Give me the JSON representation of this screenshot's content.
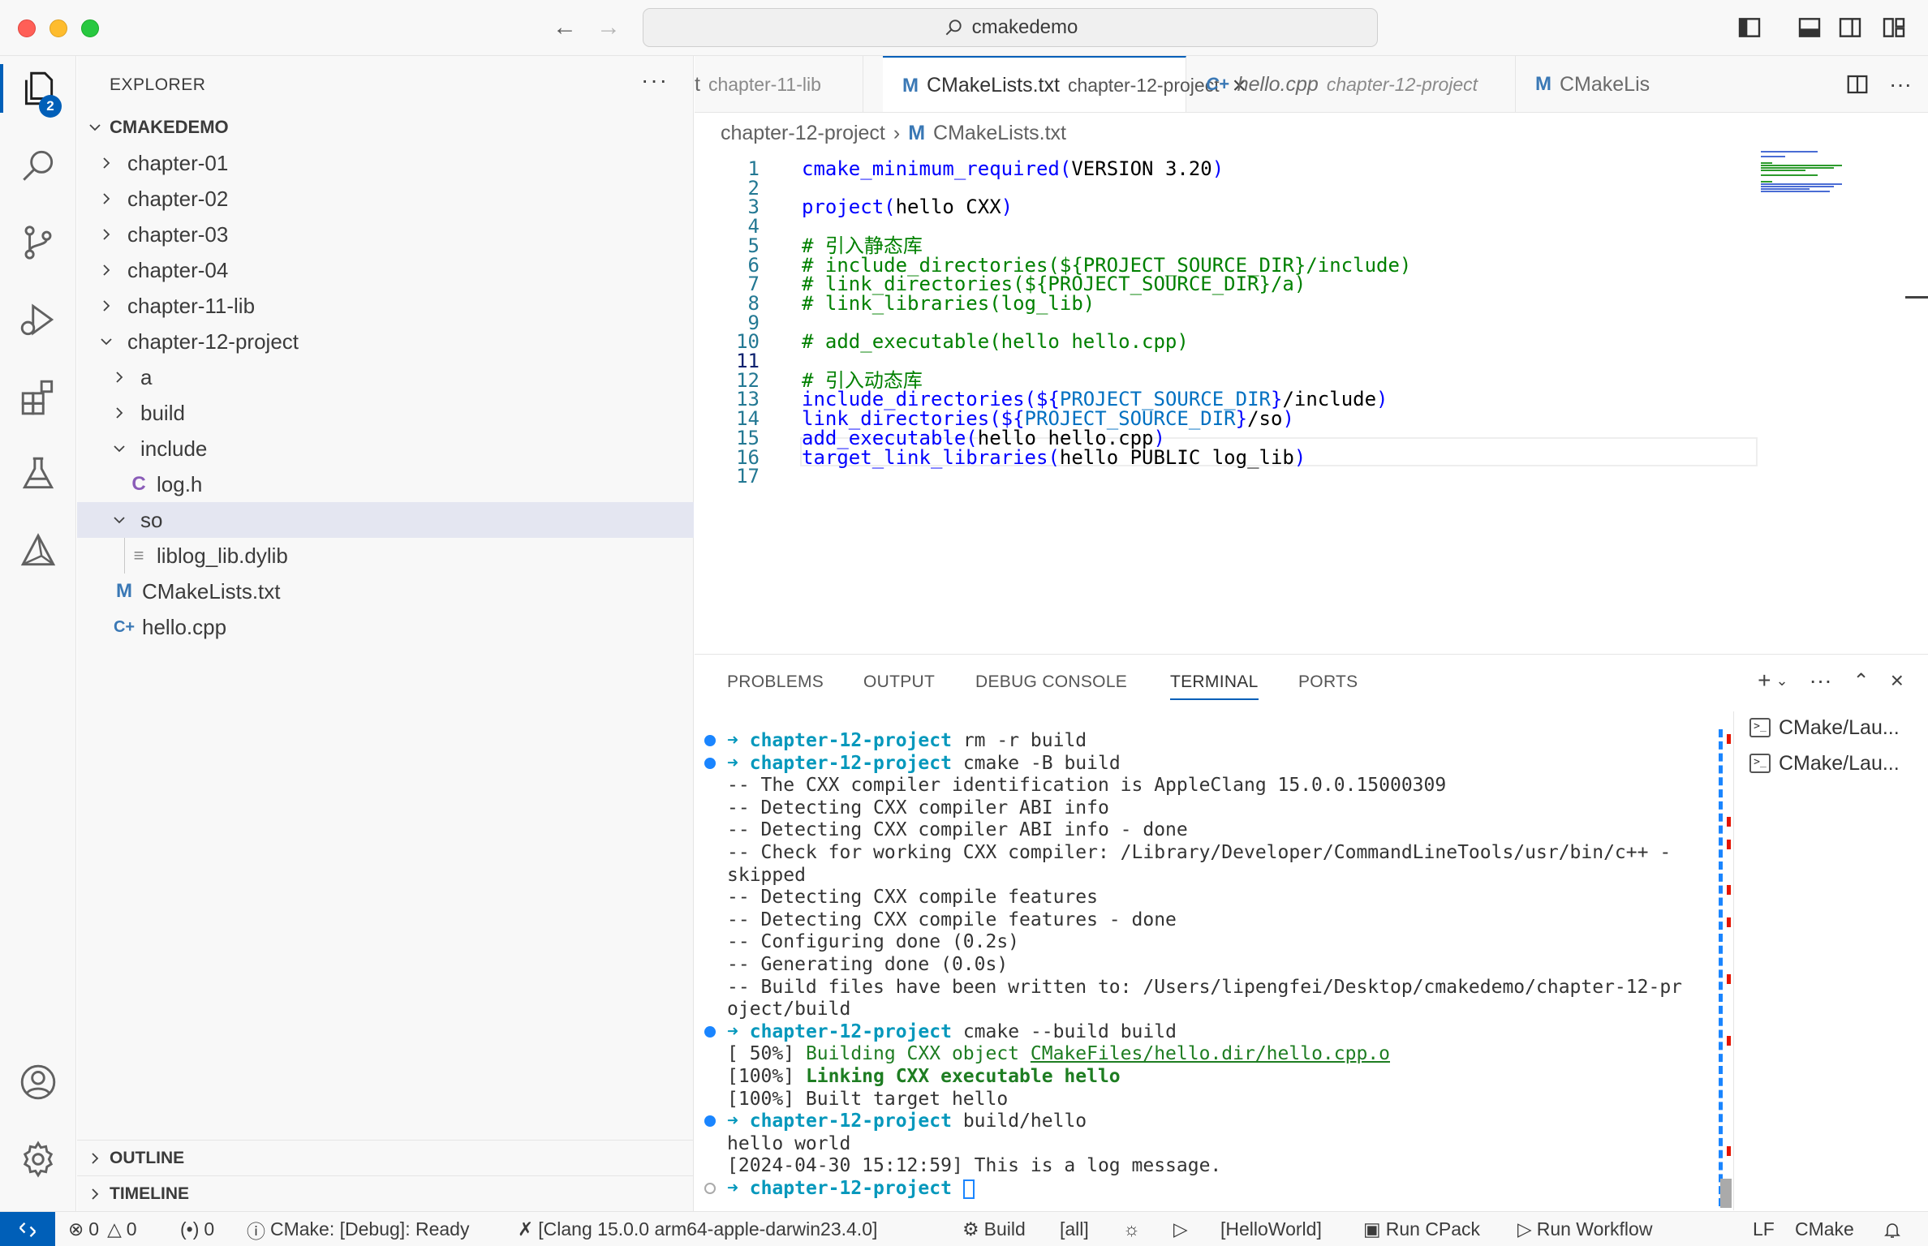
{
  "window": {
    "search_text": "cmakedemo"
  },
  "activity": {
    "explorer_badge": "2"
  },
  "explorer": {
    "title": "EXPLORER",
    "root": "CMAKEDEMO",
    "items": [
      {
        "label": "chapter-01"
      },
      {
        "label": "chapter-02"
      },
      {
        "label": "chapter-03"
      },
      {
        "label": "chapter-04"
      },
      {
        "label": "chapter-11-lib"
      },
      {
        "label": "chapter-12-project"
      },
      {
        "label": "a"
      },
      {
        "label": "build"
      },
      {
        "label": "include"
      },
      {
        "label": "log.h",
        "icon": "C"
      },
      {
        "label": "so"
      },
      {
        "label": "liblog_lib.dylib"
      },
      {
        "label": "CMakeLists.txt",
        "icon": "M"
      },
      {
        "label": "hello.cpp",
        "icon": "C+"
      }
    ],
    "outline": "OUTLINE",
    "timeline": "TIMELINE"
  },
  "tabs": [
    {
      "name": "t",
      "desc": "chapter-11-lib"
    },
    {
      "name": "CMakeLists.txt",
      "desc": "chapter-12-project",
      "icon": "M"
    },
    {
      "name": "hello.cpp",
      "desc": "chapter-12-project"
    },
    {
      "name": "CMakeLis",
      "icon": "M"
    }
  ],
  "breadcrumb": {
    "folder": "chapter-12-project",
    "file": "CMakeLists.txt"
  },
  "editor": {
    "line_numbers": [
      "1",
      "2",
      "3",
      "4",
      "5",
      "6",
      "7",
      "8",
      "9",
      "10",
      "11",
      "12",
      "13",
      "14",
      "15",
      "16",
      "17"
    ],
    "lines": [
      {
        "fn": "cmake_minimum_required",
        "open": "(",
        "body": "VERSION 3.20",
        "close": ")"
      },
      {},
      {
        "fn": "project",
        "open": "(",
        "body": "hello CXX",
        "close": ")"
      },
      {},
      {
        "comment": "# 引入静态库"
      },
      {
        "comment": "# include_directories(${PROJECT_SOURCE_DIR}/include)"
      },
      {
        "comment": "# link_directories(${PROJECT_SOURCE_DIR}/a)"
      },
      {
        "comment": "# link_libraries(log_lib)"
      },
      {},
      {
        "comment": "# add_executable(hello hello.cpp)"
      },
      {},
      {
        "comment": "# 引入动态库"
      },
      {
        "fn": "include_directories",
        "open": "(${",
        "var": "PROJECT_SOURCE_DIR",
        "close_var": "}",
        "body": "/include",
        "close": ")"
      },
      {
        "fn": "link_directories",
        "open": "(${",
        "var": "PROJECT_SOURCE_DIR",
        "close_var": "}",
        "body": "/so",
        "close": ")"
      },
      {
        "fn": "add_executable",
        "open": "(",
        "body": "hello hello.cpp",
        "close": ")"
      },
      {
        "fn": "target_link_libraries",
        "open": "(",
        "body": "hello PUBLIC log_lib",
        "close": ")"
      },
      {}
    ]
  },
  "panel": {
    "tabs": [
      "PROBLEMS",
      "OUTPUT",
      "DEBUG CONSOLE",
      "TERMINAL",
      "PORTS"
    ],
    "terminals": [
      "CMake/Lau...",
      "CMake/Lau..."
    ],
    "prompt_arrow": "➜",
    "prompt_dir": "chapter-12-project",
    "term_lines": [
      {
        "cmd": "rm -r build"
      },
      {
        "cmd": "cmake -B build"
      },
      {
        "text": "-- The CXX compiler identification is AppleClang 15.0.0.15000309"
      },
      {
        "text": "-- Detecting CXX compiler ABI info"
      },
      {
        "text": "-- Detecting CXX compiler ABI info - done"
      },
      {
        "text": "-- Check for working CXX compiler: /Library/Developer/CommandLineTools/usr/bin/c++ -"
      },
      {
        "text": "skipped"
      },
      {
        "text": "-- Detecting CXX compile features"
      },
      {
        "text": "-- Detecting CXX compile features - done"
      },
      {
        "text": "-- Configuring done (0.2s)"
      },
      {
        "text": "-- Generating done (0.0s)"
      },
      {
        "text": "-- Build files have been written to: /Users/lipengfei/Desktop/cmakedemo/chapter-12-pr"
      },
      {
        "text": "oject/build"
      },
      {
        "cmd": "cmake --build build"
      },
      {
        "pre": "[ 50%] ",
        "green": "Building CXX object ",
        "link": "CMakeFiles/hello.dir/hello.cpp.o"
      },
      {
        "pre": "[100%] ",
        "greenbold": "Linking CXX executable hello"
      },
      {
        "text": "[100%] Built target hello"
      },
      {
        "cmd": "build/hello"
      },
      {
        "text": "hello world"
      },
      {
        "text": "[2024-04-30 15:12:59] This is a log message."
      },
      {
        "cmd": ""
      }
    ]
  },
  "status": {
    "errors": "0",
    "warnings": "0",
    "ports": "0",
    "cmake_status": "CMake: [Debug]: Ready",
    "kit": "[Clang 15.0.0 arm64-apple-darwin23.4.0]",
    "build": "Build",
    "target": "[all]",
    "launch_target": "[HelloWorld]",
    "run_cpack": "Run CPack",
    "run_workflow": "Run Workflow",
    "eol": "LF",
    "language": "CMake"
  }
}
